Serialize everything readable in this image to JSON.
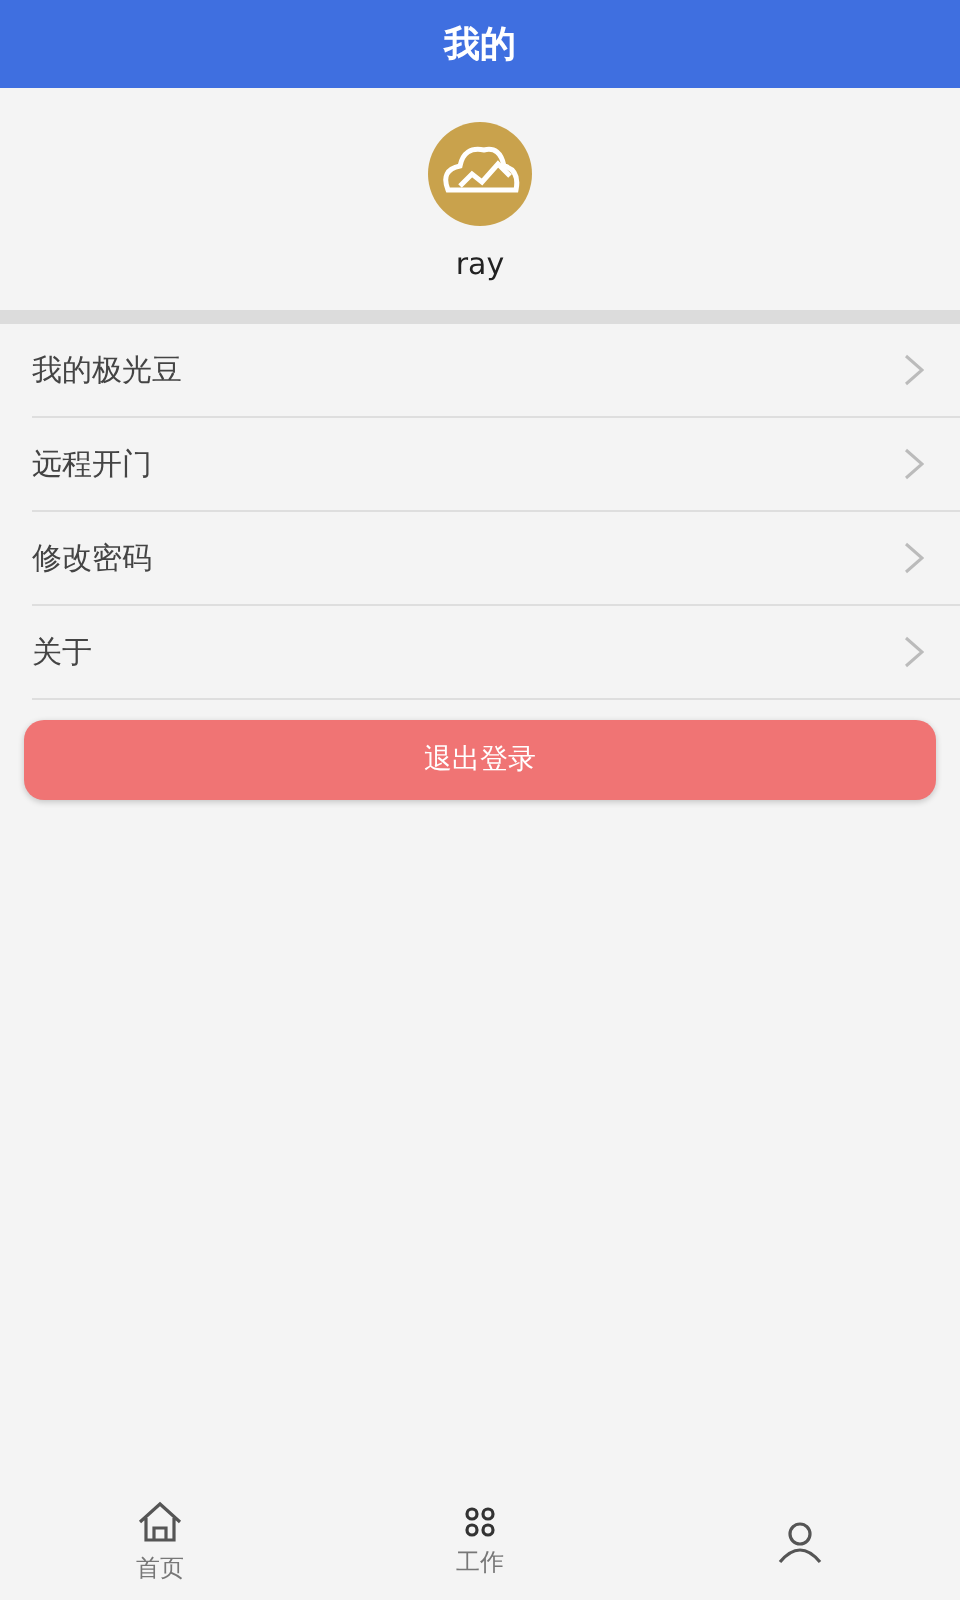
{
  "header": {
    "title": "我的"
  },
  "profile": {
    "name": "ray"
  },
  "menu": [
    {
      "label": "我的极光豆"
    },
    {
      "label": "远程开门"
    },
    {
      "label": "修改密码"
    },
    {
      "label": "关于"
    }
  ],
  "logout_button": "退出登录",
  "tab_bar": [
    {
      "kind": "home",
      "label": "首页",
      "selected": false
    },
    {
      "kind": "work",
      "label": "工作",
      "selected": false
    },
    {
      "kind": "person",
      "selected": false
    }
  ]
}
